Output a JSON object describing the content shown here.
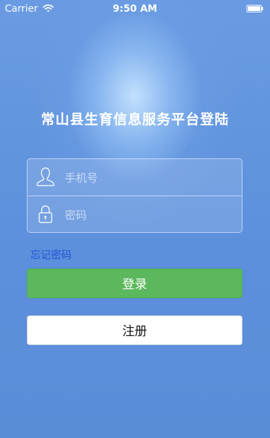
{
  "status_bar": {
    "carrier": "Carrier",
    "time": "9:50 AM",
    "icons": [
      "wifi-icon",
      "battery-icon"
    ]
  },
  "page": {
    "title": "常山县生育信息服务平台登陆"
  },
  "form": {
    "phone": {
      "placeholder": "手机号",
      "value": "",
      "icon": "user-icon"
    },
    "password": {
      "placeholder": "密码",
      "value": "",
      "icon": "lock-icon"
    }
  },
  "links": {
    "forgot_password": "忘记密码"
  },
  "buttons": {
    "login": "登录",
    "register": "注册"
  },
  "colors": {
    "background": "#5c8fdc",
    "login_button": "#5cb85c",
    "link": "#1f55d6",
    "register_button": "#ffffff"
  }
}
